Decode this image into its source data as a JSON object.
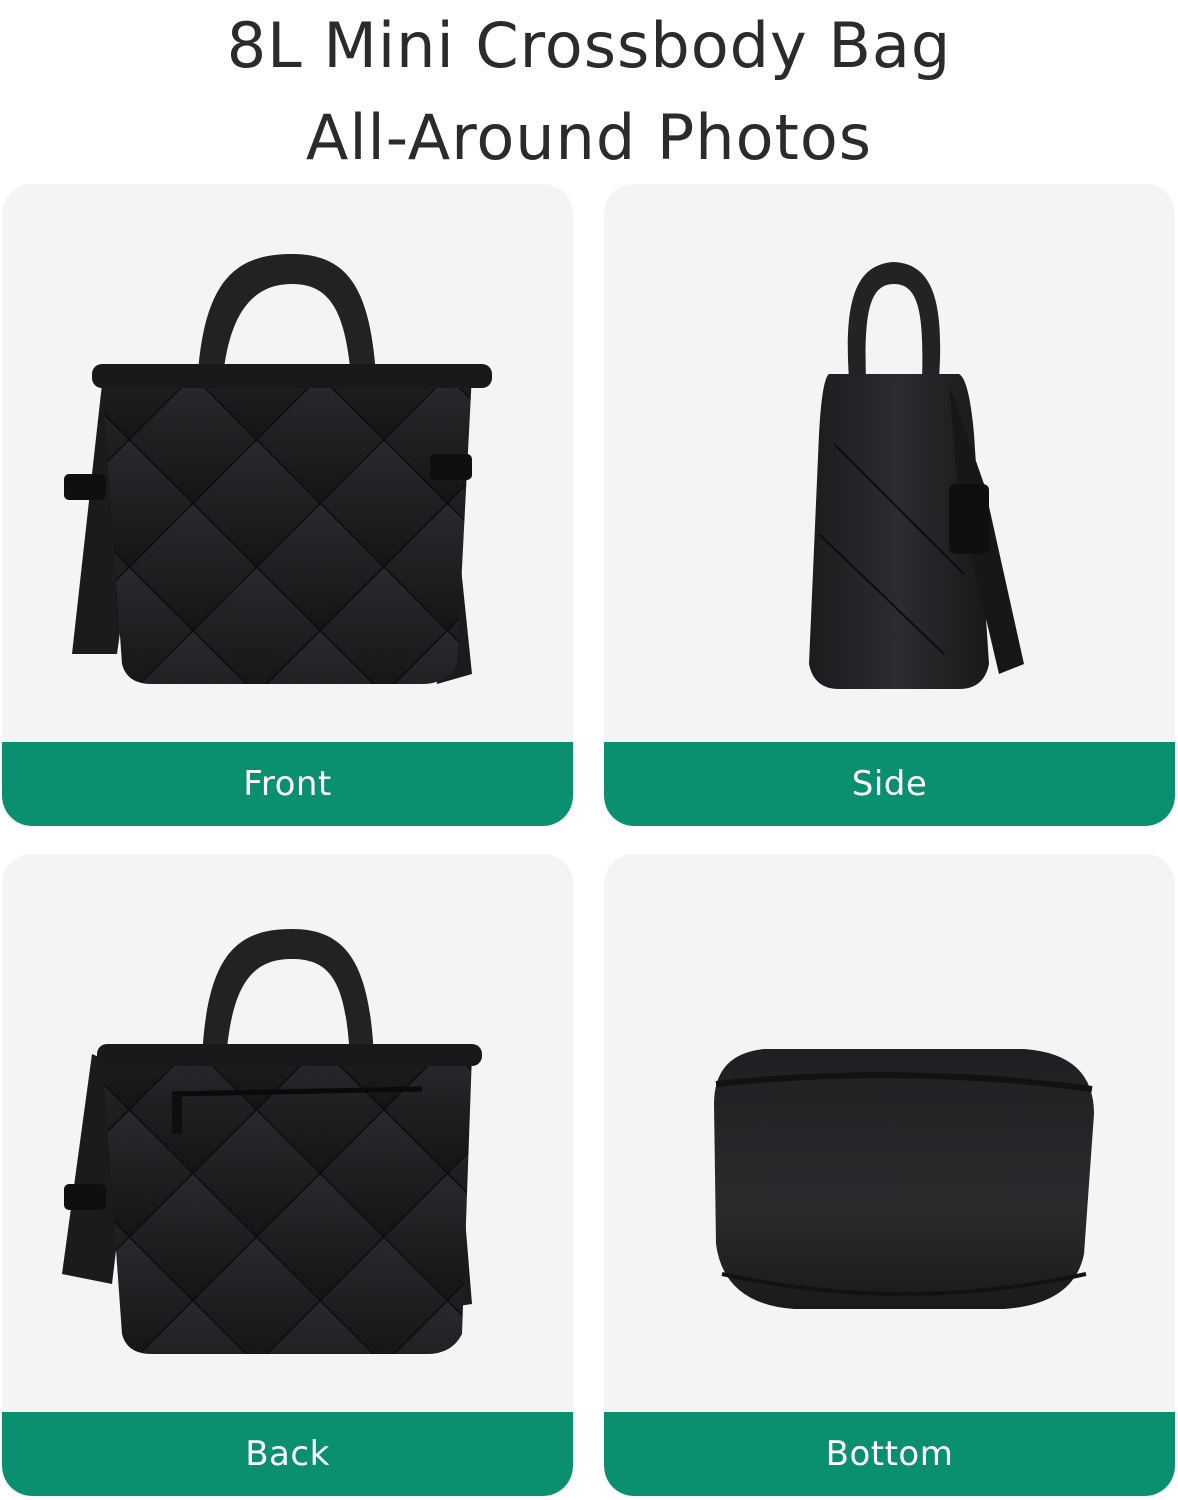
{
  "header": {
    "title_line1": "8L Mini Crossbody Bag",
    "title_line2": "All-Around Photos"
  },
  "cards": [
    {
      "label": "Front",
      "image": "bag-front-photo"
    },
    {
      "label": "Side",
      "image": "bag-side-photo"
    },
    {
      "label": "Back",
      "image": "bag-back-photo"
    },
    {
      "label": "Bottom",
      "image": "bag-bottom-photo"
    }
  ],
  "colors": {
    "label_bar": "#0a8f70",
    "card_bg": "#f4f4f4",
    "bag": "#1f1f22",
    "title_text": "#2b2b2b"
  }
}
